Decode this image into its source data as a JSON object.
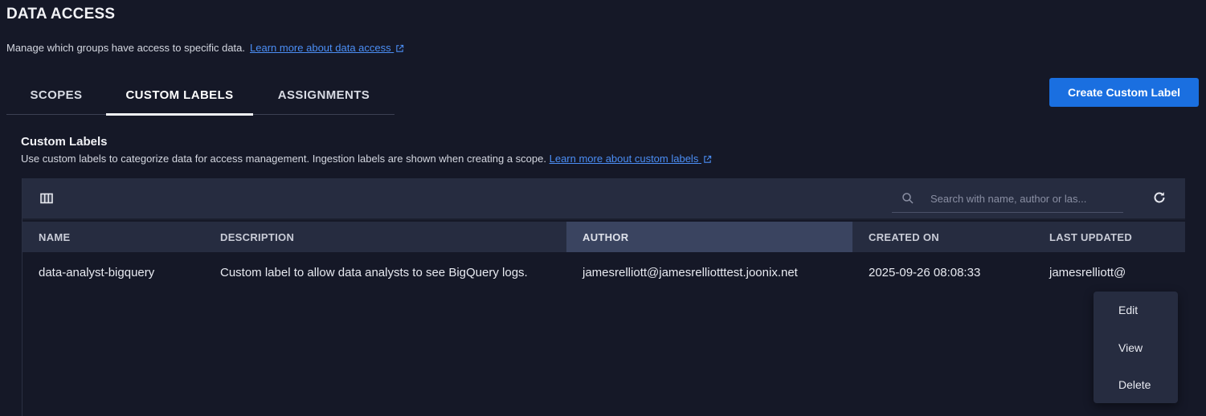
{
  "header": {
    "title": "DATA ACCESS",
    "subtitle": "Manage which groups have access to specific data.",
    "learn_more_link": "Learn more about data access"
  },
  "tabs": [
    {
      "label": "SCOPES",
      "active": false
    },
    {
      "label": "CUSTOM LABELS",
      "active": true
    },
    {
      "label": "ASSIGNMENTS",
      "active": false
    }
  ],
  "create_button_label": "Create Custom Label",
  "section": {
    "title": "Custom Labels",
    "description": "Use custom labels to categorize data for access management. Ingestion labels are shown when creating a scope.",
    "learn_more_link": "Learn more about custom labels"
  },
  "table": {
    "search_placeholder": "Search with name, author or las...",
    "columns": [
      "NAME",
      "DESCRIPTION",
      "AUTHOR",
      "CREATED ON",
      "LAST UPDATED"
    ],
    "highlighted_column": "AUTHOR",
    "rows": [
      {
        "name": "data-analyst-bigquery",
        "description": "Custom label to allow data analysts to see BigQuery logs.",
        "author": "jamesrelliott@jamesrelliotttest.joonix.net",
        "created_on": "2025-09-26 08:08:33",
        "last_updated": "jamesrelliott@"
      }
    ]
  },
  "row_menu": {
    "items": [
      "Edit",
      "View",
      "Delete"
    ]
  },
  "colors": {
    "background": "#151827",
    "toolbar": "#262c40",
    "accent_button": "#1a6fe0",
    "link": "#4b8ef5",
    "highlight_header": "#3a4460"
  },
  "icons": {
    "external_link": "external-link-icon",
    "columns": "columns-icon",
    "search": "search-icon",
    "refresh": "refresh-icon"
  }
}
